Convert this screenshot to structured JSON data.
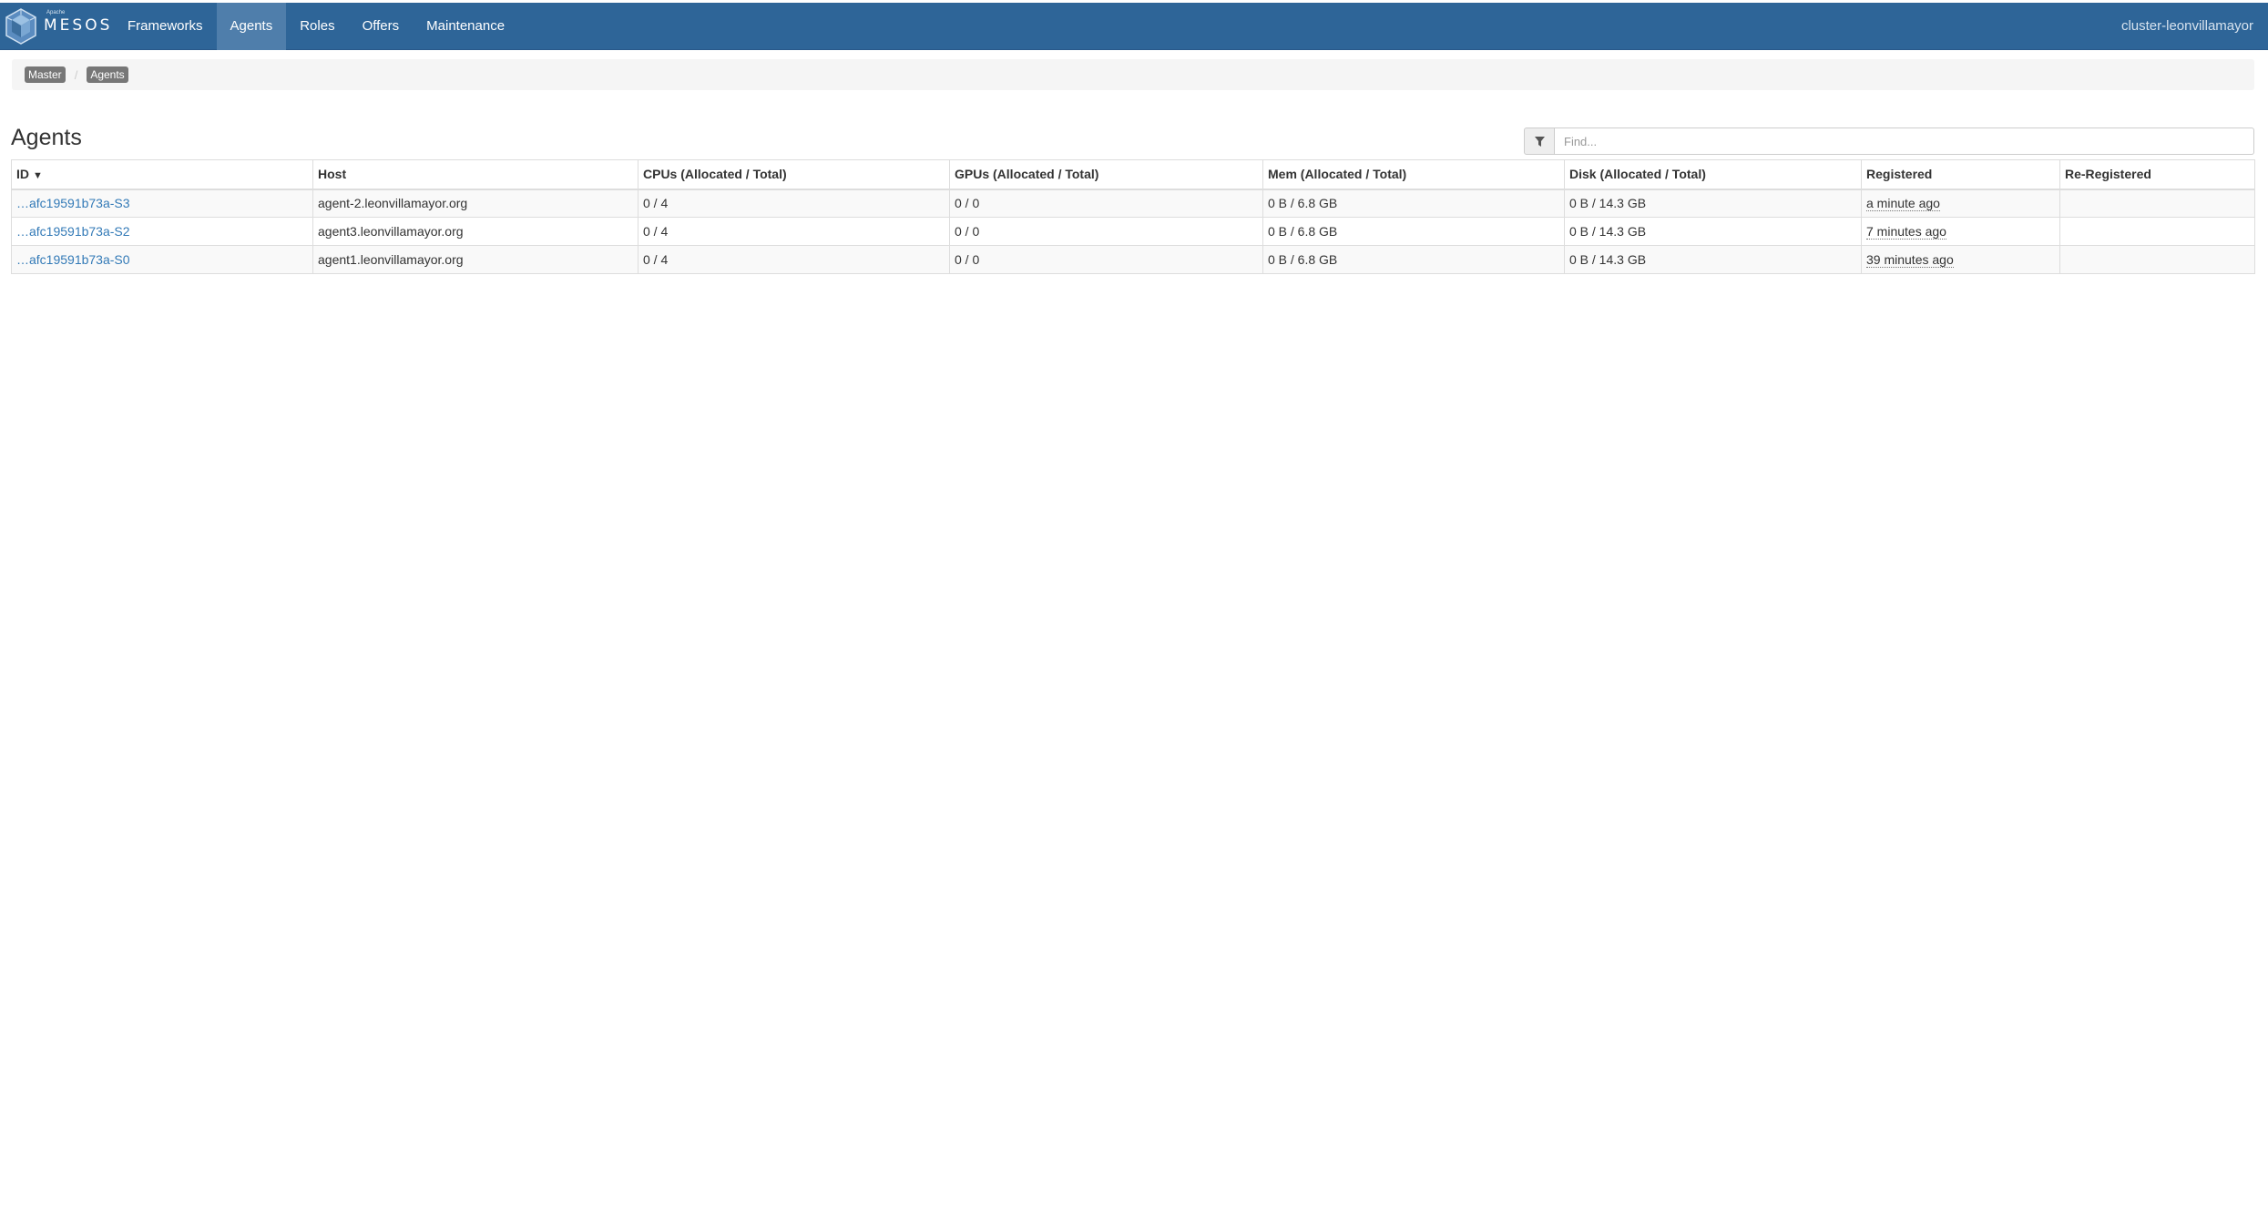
{
  "navbar": {
    "brand_small": "Apache",
    "brand_name": "MESOS",
    "links": [
      {
        "label": "Frameworks",
        "active": false
      },
      {
        "label": "Agents",
        "active": true
      },
      {
        "label": "Roles",
        "active": false
      },
      {
        "label": "Offers",
        "active": false
      },
      {
        "label": "Maintenance",
        "active": false
      }
    ],
    "cluster": "cluster-leonvillamayor",
    "colors": {
      "background": "#2e6598",
      "active": "#4f7eab"
    }
  },
  "breadcrumb": [
    "Master",
    "Agents"
  ],
  "page": {
    "title": "Agents",
    "search_placeholder": "Find...",
    "filter_icon": "filter-icon"
  },
  "table": {
    "headers": {
      "id": "ID",
      "sort_indicator": "▼",
      "host": "Host",
      "cpus": "CPUs (Allocated / Total)",
      "gpus": "GPUs (Allocated / Total)",
      "mem": "Mem (Allocated / Total)",
      "disk": "Disk (Allocated / Total)",
      "registered": "Registered",
      "reregistered": "Re-Registered"
    },
    "rows": [
      {
        "id": "…afc19591b73a-S3",
        "host": "agent-2.leonvillamayor.org",
        "cpus": "0 / 4",
        "gpus": "0 / 0",
        "mem": "0 B / 6.8 GB",
        "disk": "0 B / 14.3 GB",
        "registered": "a minute ago",
        "reregistered": ""
      },
      {
        "id": "…afc19591b73a-S2",
        "host": "agent3.leonvillamayor.org",
        "cpus": "0 / 4",
        "gpus": "0 / 0",
        "mem": "0 B / 6.8 GB",
        "disk": "0 B / 14.3 GB",
        "registered": "7 minutes ago",
        "reregistered": ""
      },
      {
        "id": "…afc19591b73a-S0",
        "host": "agent1.leonvillamayor.org",
        "cpus": "0 / 4",
        "gpus": "0 / 0",
        "mem": "0 B / 6.8 GB",
        "disk": "0 B / 14.3 GB",
        "registered": "39 minutes ago",
        "reregistered": ""
      }
    ]
  }
}
